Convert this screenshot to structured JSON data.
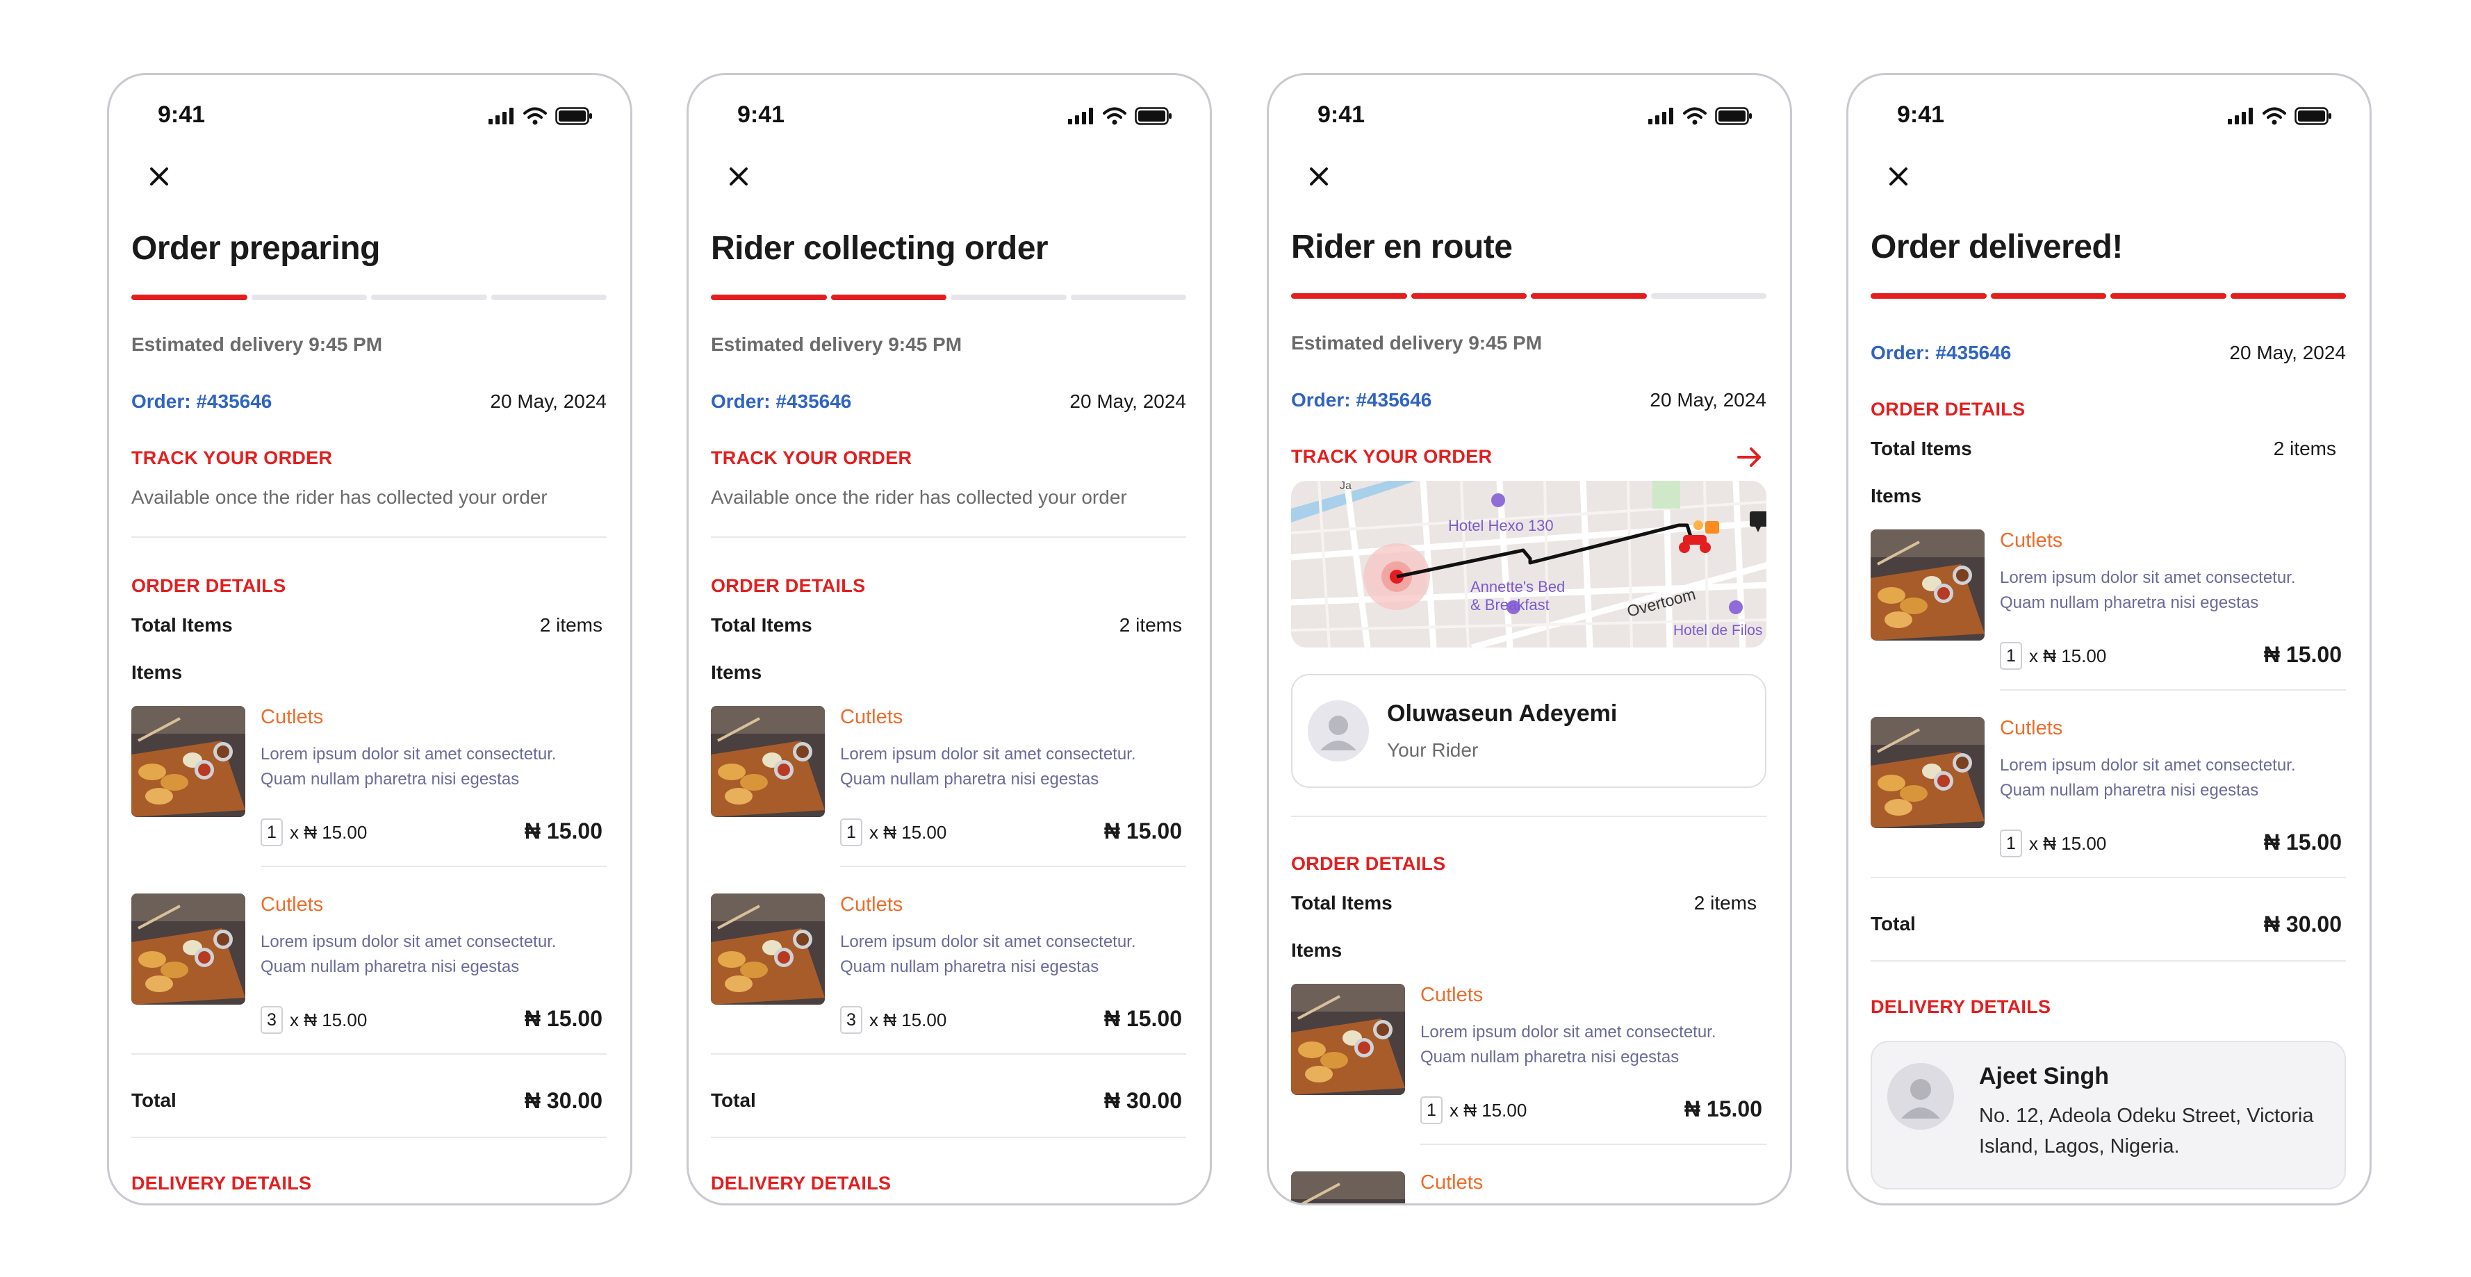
{
  "screens": [
    {
      "status_time": "9:41",
      "title": "Order preparing",
      "progress_steps_complete": 1,
      "progress_steps_total": 4,
      "eta": "Estimated delivery 9:45 PM",
      "order_label": "Order: #435646",
      "date": "20 May, 2024",
      "track_heading": "TRACK YOUR ORDER",
      "track_note": "Available once the rider has collected your order",
      "order_details_heading": "ORDER DETAILS",
      "total_items_label": "Total Items",
      "total_items_value": "2 items",
      "items_label": "Items",
      "items": [
        {
          "name": "Cutlets",
          "desc": "Lorem ipsum dolor sit amet consectetur. Quam nullam pharetra nisi egestas",
          "qty": "1",
          "unit": "x ₦ 15.00",
          "price": "₦ 15.00"
        },
        {
          "name": "Cutlets",
          "desc": "Lorem ipsum dolor sit amet consectetur. Quam nullam pharetra nisi egestas",
          "qty": "3",
          "unit": "x ₦ 15.00",
          "price": "₦ 15.00"
        }
      ],
      "total_label": "Total",
      "total_value": "₦ 30.00",
      "delivery_heading": "DELIVERY DETAILS"
    },
    {
      "status_time": "9:41",
      "title": "Rider collecting order",
      "progress_steps_complete": 2,
      "progress_steps_total": 4,
      "eta": "Estimated delivery 9:45 PM",
      "order_label": "Order: #435646",
      "date": "20 May, 2024",
      "track_heading": "TRACK YOUR ORDER",
      "track_note": "Available once the rider has collected your order",
      "order_details_heading": "ORDER DETAILS",
      "total_items_label": "Total Items",
      "total_items_value": "2 items",
      "items_label": "Items",
      "items": [
        {
          "name": "Cutlets",
          "desc": "Lorem ipsum dolor sit amet consectetur. Quam nullam pharetra nisi egestas",
          "qty": "1",
          "unit": "x ₦ 15.00",
          "price": "₦ 15.00"
        },
        {
          "name": "Cutlets",
          "desc": "Lorem ipsum dolor sit amet consectetur. Quam nullam pharetra nisi egestas",
          "qty": "3",
          "unit": "x ₦ 15.00",
          "price": "₦ 15.00"
        }
      ],
      "total_label": "Total",
      "total_value": "₦ 30.00",
      "delivery_heading": "DELIVERY DETAILS"
    },
    {
      "status_time": "9:41",
      "title": "Rider en route",
      "progress_steps_complete": 3,
      "progress_steps_total": 4,
      "eta": "Estimated delivery 9:45 PM",
      "order_label": "Order: #435646",
      "date": "20 May, 2024",
      "track_heading": "TRACK YOUR ORDER",
      "map_labels": {
        "hotel1": "Hotel Hexo 130",
        "bnb_line1": "Annette's Bed",
        "bnb_line2": "& Breakfast",
        "street": "Overtoom",
        "hotel2": "Hotel de Filos",
        "corner": "Ja"
      },
      "rider_name": "Oluwaseun Adeyemi",
      "rider_role": "Your Rider",
      "order_details_heading": "ORDER DETAILS",
      "total_items_label": "Total Items",
      "total_items_value": "2 items",
      "items_label": "Items",
      "items": [
        {
          "name": "Cutlets",
          "desc": "Lorem ipsum dolor sit amet consectetur. Quam nullam pharetra nisi egestas",
          "qty": "1",
          "unit": "x ₦ 15.00",
          "price": "₦ 15.00"
        },
        {
          "name": "Cutlets"
        }
      ]
    },
    {
      "status_time": "9:41",
      "title": "Order delivered!",
      "progress_steps_complete": 4,
      "progress_steps_total": 4,
      "order_label": "Order: #435646",
      "date": "20 May, 2024",
      "order_details_heading": "ORDER DETAILS",
      "total_items_label": "Total Items",
      "total_items_value": "2 items",
      "items_label": "Items",
      "items": [
        {
          "name": "Cutlets",
          "desc": "Lorem ipsum dolor sit amet consectetur. Quam nullam pharetra nisi egestas",
          "qty": "1",
          "unit": "x ₦ 15.00",
          "price": "₦ 15.00"
        },
        {
          "name": "Cutlets",
          "desc": "Lorem ipsum dolor sit amet consectetur. Quam nullam pharetra nisi egestas",
          "qty": "1",
          "unit": "x ₦ 15.00",
          "price": "₦ 15.00"
        }
      ],
      "total_label": "Total",
      "total_value": "₦ 30.00",
      "delivery_heading": "DELIVERY DETAILS",
      "recipient_name": "Ajeet Singh",
      "recipient_address": "No. 12, Adeola Odeku Street, Victoria Island, Lagos, Nigeria."
    }
  ],
  "colors": {
    "accent_red": "#e41e1e",
    "order_blue": "#2f63c4",
    "item_orange": "#ee6c2a",
    "muted_gray": "#6b6b6b"
  },
  "icons": [
    "close-icon",
    "signal-icon",
    "wifi-icon",
    "battery-icon",
    "arrow-right-icon",
    "user-avatar-icon",
    "scooter-icon",
    "location-pin-icon"
  ]
}
